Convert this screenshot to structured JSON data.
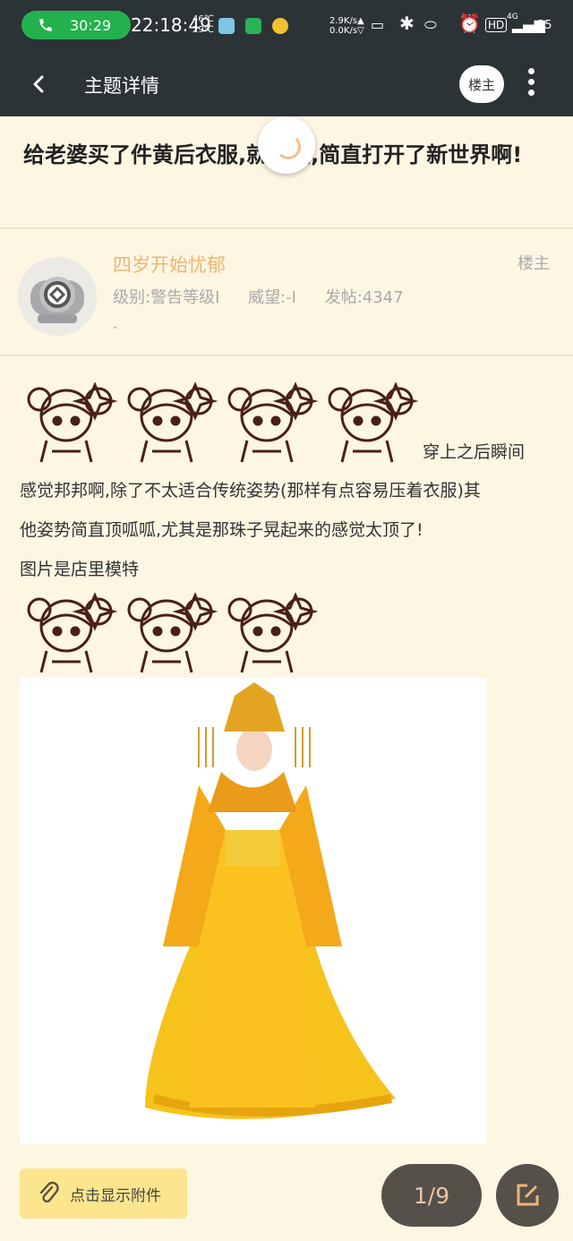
{
  "status_bar": {
    "call_duration": "30:29",
    "clock": "22:18:49",
    "temp_high": "46℃",
    "temp_low": "29℃",
    "net_up": "2.9K/s▲",
    "net_down": "0.0K/s▽",
    "network": "4G",
    "battery": "35"
  },
  "topbar": {
    "title": "主题详情",
    "owner_label": "楼主"
  },
  "thread": {
    "title": "给老婆买了件黄后衣服,就动兴,简直打开了新世界啊!"
  },
  "author": {
    "name": "四岁开始忧郁",
    "tag": "楼主",
    "level": "级别:警告等级Ⅰ",
    "prestige": "威望:-Ⅰ",
    "posts": "发帖:4347",
    "extra": "-"
  },
  "post": {
    "line1": "穿上之后瞬间",
    "line2": "感觉邦邦啊,除了不太适合传统姿势(那样有点容易压着衣服)其",
    "line3": "他姿势简直顶呱呱,尤其是那珠子晃起来的感觉太顶了!",
    "line4": "图片是店里模特"
  },
  "bottom": {
    "attach_label": "点击显示附件",
    "page_indicator": "1/9"
  },
  "colors": {
    "bar_bg": "#2c3336",
    "page_bg": "#fdf6e3",
    "author_name": "#efb571",
    "attach_bg": "#fbe58e",
    "fab_bg": "#55504a",
    "call_green": "#23b14d"
  }
}
